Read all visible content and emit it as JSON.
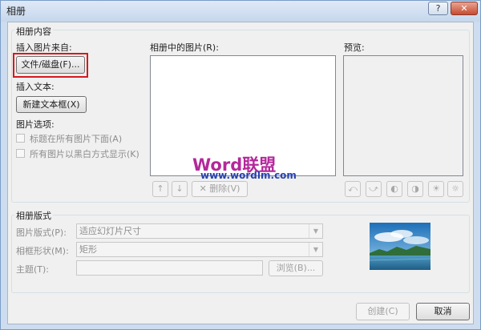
{
  "window": {
    "title": "相册",
    "help_label": "?",
    "close_label": "✕"
  },
  "content": {
    "group_label": "相册内容",
    "insert_from_label": "插入图片来自:",
    "file_disk_button": "文件/磁盘(F)...",
    "insert_text_label": "插入文本:",
    "new_textbox_button": "新建文本框(X)",
    "picture_options_label": "图片选项:",
    "caption_below_label": "标题在所有图片下面(A)",
    "all_bw_label": "所有图片以黑白方式显示(K)",
    "pictures_in_album_label": "相册中的图片(R):",
    "preview_label": "预览:",
    "delete_button": "删除(V)"
  },
  "watermark": {
    "logo_text": "Word联盟",
    "url_text": "www.wordlm.com"
  },
  "layout_group": {
    "group_label": "相册版式",
    "picture_layout_label": "图片版式(P):",
    "picture_layout_value": "适应幻灯片尺寸",
    "frame_shape_label": "相框形状(M):",
    "frame_shape_value": "矩形",
    "theme_label": "主题(T):",
    "theme_value": "",
    "browse_button": "浏览(B)..."
  },
  "footer": {
    "create_button": "创建(C)",
    "cancel_button": "取消"
  },
  "icons": [
    "up-arrow-icon",
    "down-arrow-icon",
    "delete-x-icon",
    "rotate-left-icon",
    "rotate-right-icon",
    "contrast-up-icon",
    "contrast-down-icon",
    "brightness-up-icon",
    "brightness-down-icon"
  ],
  "colors": {
    "highlight_red": "#d7191c",
    "titlebar": "#cddcee",
    "dialog_bg": "#f0f0f0"
  }
}
